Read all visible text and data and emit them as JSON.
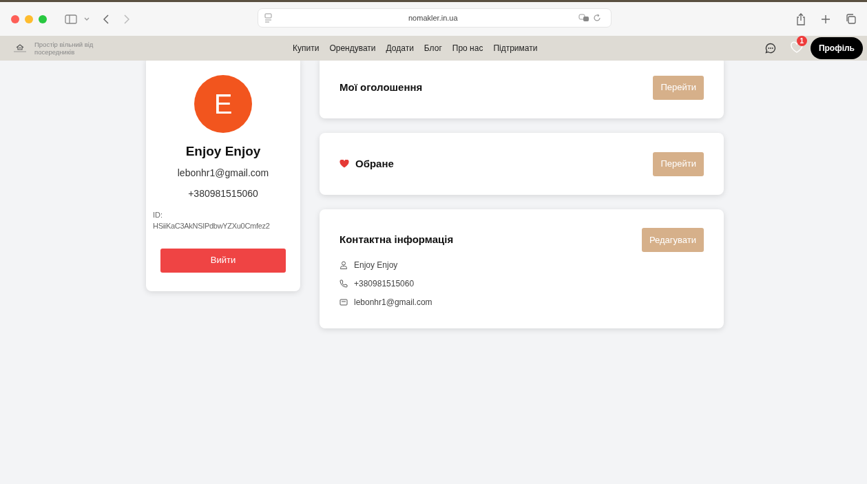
{
  "browser": {
    "address": "nomakler.in.ua"
  },
  "site_nav": {
    "tagline": "Простір вільний від посередників",
    "links": [
      "Купити",
      "Орендувати",
      "Додати",
      "Блог",
      "Про нас",
      "Підтримати"
    ],
    "favorites_count": "1",
    "profile_button": "Профіль"
  },
  "profile_card": {
    "initial": "E",
    "name": "Enjoy Enjoy",
    "email": "lebonhr1@gmail.com",
    "phone": "+380981515060",
    "id_label": "ID:",
    "id_value": "HSiiKaC3AkNSIPdbwYZXu0Cmfez2",
    "logout_button": "Вийти"
  },
  "sections": [
    {
      "title": "Мої оголошення",
      "kind": "plain",
      "button": "Перейти"
    },
    {
      "title": "Обране",
      "kind": "favorites",
      "button": "Перейти"
    },
    {
      "title": "Контактна інформація",
      "kind": "contact",
      "button": "Редагувати",
      "items": [
        {
          "kind": "person",
          "text": "Enjoy Enjoy"
        },
        {
          "kind": "phone",
          "text": "+380981515060"
        },
        {
          "kind": "mail",
          "text": "lebonhr1@gmail.com"
        }
      ]
    }
  ]
}
